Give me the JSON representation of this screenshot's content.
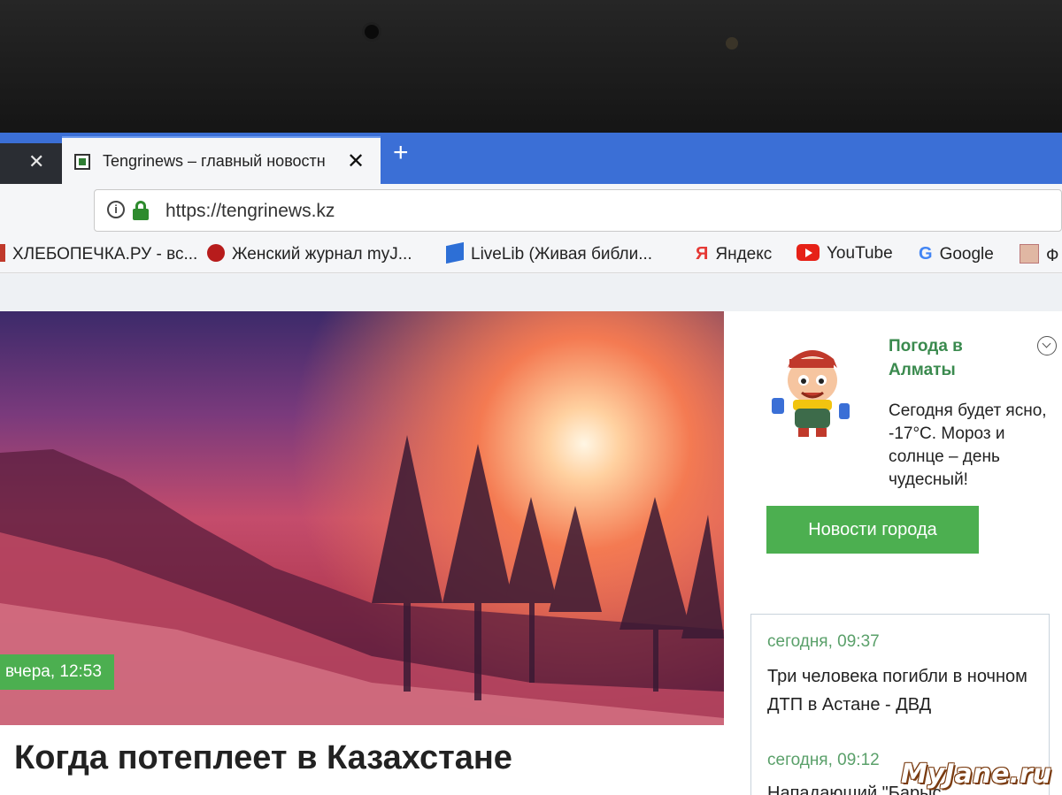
{
  "browser": {
    "tab_title": "Tengrinews – главный новостн",
    "tab_close": "✕",
    "prev_tab_close": "✕",
    "new_tab": "+",
    "url": "https://tengrinews.kz",
    "info_icon": "i"
  },
  "bookmarks": [
    {
      "label": "ХЛЕБОПЕЧКА.РУ - вс...",
      "icon": "bread-icon"
    },
    {
      "label": "Женский журнал myJ...",
      "icon": "cherry-icon"
    },
    {
      "label": "LiveLib (Живая библи...",
      "icon": "book-icon"
    },
    {
      "label": "Яндекс",
      "icon": "yandex-icon",
      "glyph": "Я"
    },
    {
      "label": "YouTube",
      "icon": "youtube-icon"
    },
    {
      "label": "Google",
      "icon": "google-icon",
      "glyph": "G"
    },
    {
      "label": "Ф",
      "icon": "bookmark-icon"
    }
  ],
  "article": {
    "time": "вчера, 12:53",
    "headline": "Когда потеплеет в Казахстане"
  },
  "weather": {
    "title": "Погода в Алматы",
    "text": "Сегодня будет ясно, -17°C. Мороз и солнце – день чудесный!",
    "button": "Новости города"
  },
  "news": [
    {
      "time": "сегодня, 09:37",
      "title": "Три человека погибли в ночном ДТП в Астане - ДВД"
    },
    {
      "time": "сегодня, 09:12",
      "title": "Нападающий \"Барыс\""
    }
  ],
  "watermark": "MyJane.ru",
  "colors": {
    "accent_green": "#4caf50",
    "tab_strip": "#3b6fd6",
    "lock_green": "#2e8b2e"
  }
}
